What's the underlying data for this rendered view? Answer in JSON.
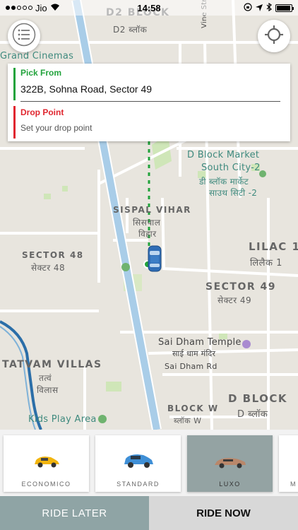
{
  "status_bar": {
    "carrier": "Jio",
    "time": "14:58",
    "battery_level": 0.95
  },
  "map": {
    "labels": {
      "d2_block": "D2 BLOCK",
      "d2_block_hindi": "D2 ब्लॉक",
      "grand_cinemas": "Grand Cinemas",
      "vine_street": "Vine Street",
      "d_block_market": "D Block Market",
      "south_city_2": "South City-2",
      "d_block_market_hindi": "डी ब्लॉक मार्केट",
      "south_city_2_hindi": "साउथ सिटी -2",
      "sispal_vihar": "SISPAL VIHAR",
      "sispal_vihar_hindi_1": "सिसपाल",
      "sispal_vihar_hindi_2": "विहार",
      "sector_48": "SECTOR 48",
      "sector_48_hindi": "सेक्टर 48",
      "lilac_1": "LILAC 1",
      "lilac_1_hindi": "लिलैक 1",
      "sector_49": "SECTOR 49",
      "sector_49_hindi": "सेक्टर 49",
      "sai_dham_temple": "Sai Dham Temple",
      "sai_dham_temple_hindi": "साई धाम मंदिर",
      "sai_dham_rd": "Sai Dham Rd",
      "tatvam_villas": "TATVAM VILLAS",
      "tatvam_villas_hindi_1": "तत्वं",
      "tatvam_villas_hindi_2": "विलास",
      "d_block": "D BLOCK",
      "d_block_hindi": "D ब्लॉक",
      "block_w": "BLOCK W",
      "block_w_hindi": "ब्लॉक W",
      "kids_play_area": "Kids Play Area"
    },
    "colors": {
      "road": "#ffffff",
      "highway": "#a9cde8",
      "park": "#cfe6b8",
      "metro": "#2b6ea8",
      "route": "#22a33c"
    }
  },
  "menu_icon": "hamburger-icon",
  "locate_icon": "crosshair-icon",
  "address": {
    "pick_label": "Pick From",
    "pick_value": "322B, Sohna Road, Sector 49",
    "drop_label": "Drop Point",
    "drop_placeholder": "Set your drop point",
    "pick_color": "#22a33c",
    "drop_color": "#e0262f"
  },
  "vehicles": [
    {
      "label": "ECONOMICO",
      "color": "#f2b50f",
      "selected": false
    },
    {
      "label": "STANDARD",
      "color": "#3f8fd6",
      "selected": false
    },
    {
      "label": "LUXO",
      "color": "#b9876a",
      "selected": true
    },
    {
      "label": "M",
      "color": "#888888",
      "selected": false
    }
  ],
  "actions": {
    "ride_later": "RIDE LATER",
    "ride_now": "RIDE NOW"
  }
}
